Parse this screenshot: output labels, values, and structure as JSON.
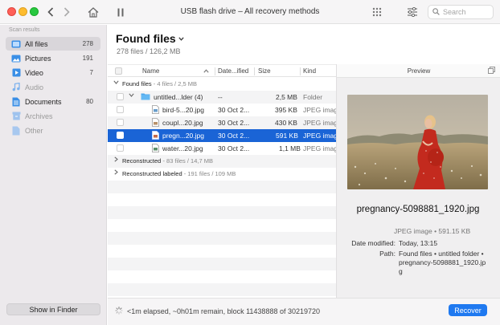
{
  "window": {
    "title": "USB flash drive – All recovery methods"
  },
  "toolbar": {
    "search_placeholder": "Search"
  },
  "sidebar": {
    "heading": "Scan results",
    "items": [
      {
        "label": "All files",
        "count": "278",
        "icon": "all-files-icon",
        "active": true
      },
      {
        "label": "Pictures",
        "count": "191",
        "icon": "pictures-icon"
      },
      {
        "label": "Video",
        "count": "7",
        "icon": "video-icon"
      },
      {
        "label": "Audio",
        "count": "",
        "icon": "audio-icon"
      },
      {
        "label": "Documents",
        "count": "80",
        "icon": "documents-icon"
      },
      {
        "label": "Archives",
        "count": "",
        "icon": "archives-icon"
      },
      {
        "label": "Other",
        "count": "",
        "icon": "other-icon"
      }
    ],
    "show_in_finder": "Show in Finder"
  },
  "main": {
    "title": "Found files",
    "subtitle": "278 files / 126,2 MB",
    "columns": {
      "name": "Name",
      "date": "Date...ified",
      "size": "Size",
      "kind": "Kind"
    },
    "groups": [
      {
        "label": "Found files",
        "meta": " - 4 files / 2,5 MB"
      },
      {
        "label": "Reconstructed",
        "meta": " - 83 files / 14,7 MB"
      },
      {
        "label": "Reconstructed labeled",
        "meta": " - 191 files / 109 MB"
      }
    ],
    "folder": {
      "name": "untitled...lder (4)",
      "date": "--",
      "size": "2,5 MB",
      "kind": "Folder"
    },
    "files": [
      {
        "name": "bird-5...20.jpg",
        "date": "30 Oct 2...",
        "size": "395 KB",
        "kind": "JPEG imag"
      },
      {
        "name": "coupl...20.jpg",
        "date": "30 Oct 2...",
        "size": "430 KB",
        "kind": "JPEG imag"
      },
      {
        "name": "pregn...20.jpg",
        "date": "30 Oct 2...",
        "size": "591 KB",
        "kind": "JPEG imag",
        "selected": true
      },
      {
        "name": "water...20.jpg",
        "date": "30 Oct 2...",
        "size": "1,1 MB",
        "kind": "JPEG imag"
      }
    ]
  },
  "preview": {
    "header": "Preview",
    "file_name": "pregnancy-5098881_1920.jpg",
    "kind_size": "JPEG image • 591.15 KB",
    "date_label": "Date modified:",
    "date_value": "Today, 13:15",
    "path_label": "Path:",
    "path_line1": "Found files • untitled folder •",
    "path_line2": "pregnancy-5098881_1920.jp",
    "path_line3": "g"
  },
  "status": {
    "text": "<1m elapsed, ~0h01m remain, block 11438888 of 30219720",
    "recover_label": "Recover"
  },
  "colors": {
    "selection": "#1a64d6",
    "accent_button": "#1f79f0"
  }
}
